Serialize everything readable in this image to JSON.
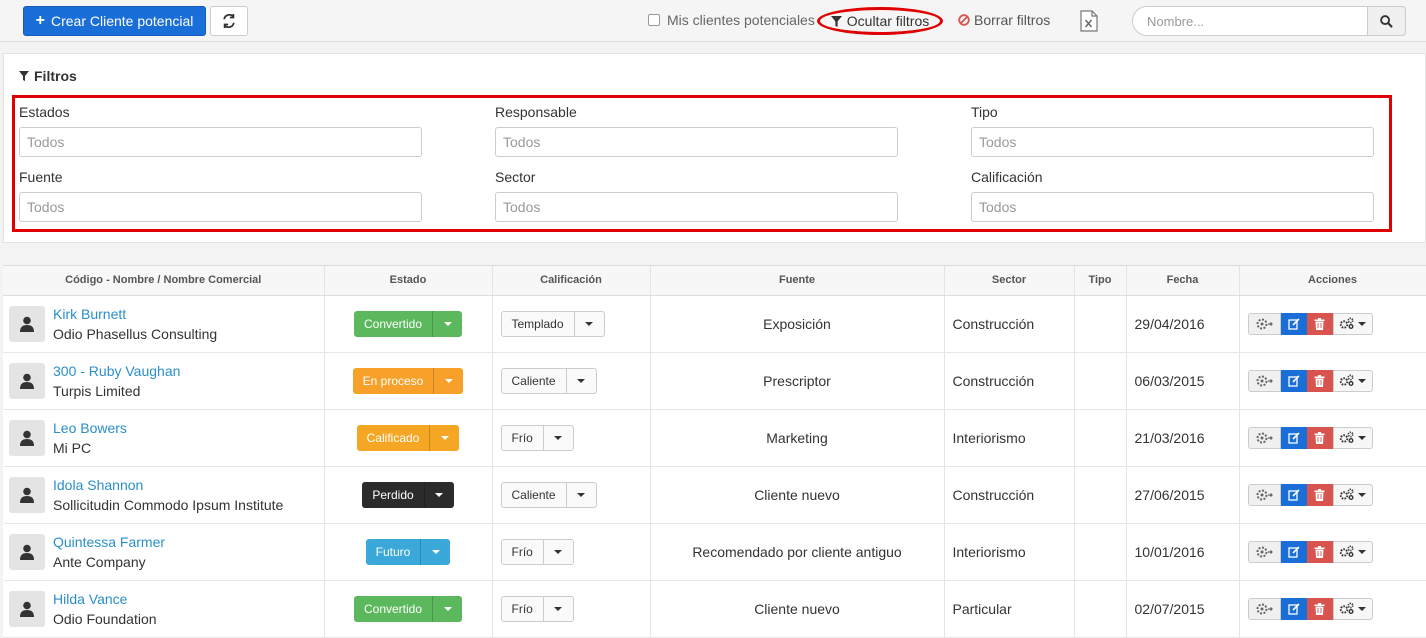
{
  "toolbar": {
    "create_label": "Crear Cliente potencial",
    "my_leads_label": "Mis clientes potenciales",
    "hide_filters_label": "Ocultar filtros",
    "clear_filters_label": "Borrar filtros",
    "search_placeholder": "Nombre..."
  },
  "filters": {
    "title": "Filtros",
    "fields": [
      {
        "label": "Estados",
        "placeholder": "Todos"
      },
      {
        "label": "Responsable",
        "placeholder": "Todos"
      },
      {
        "label": "Tipo",
        "placeholder": "Todos"
      },
      {
        "label": "Fuente",
        "placeholder": "Todos"
      },
      {
        "label": "Sector",
        "placeholder": "Todos"
      },
      {
        "label": "Calificación",
        "placeholder": "Todos"
      }
    ]
  },
  "table": {
    "headers": [
      "Código - Nombre / Nombre Comercial",
      "Estado",
      "Calificación",
      "Fuente",
      "Sector",
      "Tipo",
      "Fecha",
      "Acciones"
    ],
    "rows": [
      {
        "name": "Kirk Burnett",
        "company": "Odio Phasellus Consulting",
        "status": "Convertido",
        "status_color": "#5cb85c",
        "rating": "Templado",
        "source": "Exposición",
        "sector": "Construcción",
        "type": "",
        "date": "29/04/2016"
      },
      {
        "name": "300 - Ruby Vaughan",
        "company": "Turpis Limited",
        "status": "En proceso",
        "status_color": "#f7a12b",
        "rating": "Caliente",
        "source": "Prescriptor",
        "sector": "Construcción",
        "type": "",
        "date": "06/03/2015"
      },
      {
        "name": "Leo Bowers",
        "company": "Mi PC",
        "status": "Calificado",
        "status_color": "#f5a623",
        "rating": "Frío",
        "source": "Marketing",
        "sector": "Interiorismo",
        "type": "",
        "date": "21/03/2016"
      },
      {
        "name": "Idola Shannon",
        "company": "Sollicitudin Commodo Ipsum Institute",
        "status": "Perdido",
        "status_color": "#2b2b2b",
        "rating": "Caliente",
        "source": "Cliente nuevo",
        "sector": "Construcción",
        "type": "",
        "date": "27/06/2015"
      },
      {
        "name": "Quintessa Farmer",
        "company": "Ante Company",
        "status": "Futuro",
        "status_color": "#3aa8d8",
        "rating": "Frío",
        "source": "Recomendado por cliente antiguo",
        "sector": "Interiorismo",
        "type": "",
        "date": "10/01/2016"
      },
      {
        "name": "Hilda Vance",
        "company": "Odio Foundation",
        "status": "Convertido",
        "status_color": "#5cb85c",
        "rating": "Frío",
        "source": "Cliente nuevo",
        "sector": "Particular",
        "type": "",
        "date": "02/07/2015"
      }
    ]
  },
  "icons": {
    "create": "plus-icon",
    "refresh": "refresh-icon",
    "filter": "filter-icon",
    "clear": "ban-icon",
    "export": "excel-icon",
    "search": "search-icon",
    "avatar": "user-icon"
  }
}
